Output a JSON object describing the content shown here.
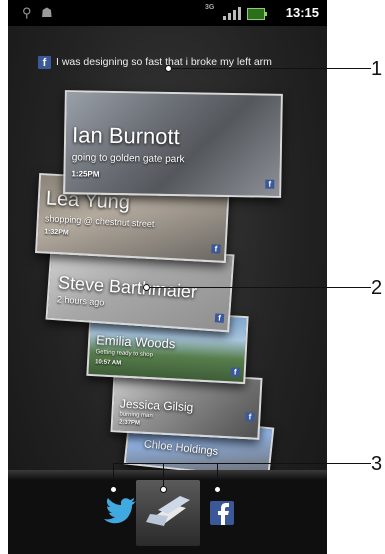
{
  "statusbar": {
    "usb_icon": "usb-icon",
    "android_icon": "android-debug-icon",
    "network": "3G",
    "time": "13:15"
  },
  "status_update": {
    "icon": "facebook-icon",
    "text": "I was designing so fast that i broke my left arm"
  },
  "cards": [
    {
      "name": "Ian Burnott",
      "sub": "going to golden gate park",
      "time": "1:25PM",
      "source": "facebook-icon"
    },
    {
      "name": "Lea Yung",
      "sub": "shopping @ chestnut street",
      "time": "1:32PM",
      "source": "facebook-icon"
    },
    {
      "name": "Steve Barthmaier",
      "sub": "2 hours ago",
      "source": "facebook-icon"
    },
    {
      "name": "Emilia Woods",
      "sub": "Getting ready to shop",
      "time": "10:57 AM",
      "source": "facebook-icon"
    },
    {
      "name": "Jessica Gilsig",
      "sub": "burning man",
      "time": "2:37PM",
      "source": "facebook-icon"
    },
    {
      "name": "Chloe Holdings",
      "source": "facebook-icon"
    }
  ],
  "dock": {
    "items": [
      "twitter-icon",
      "timescape-icon",
      "facebook-icon"
    ]
  },
  "callouts": [
    "1",
    "2",
    "3"
  ]
}
